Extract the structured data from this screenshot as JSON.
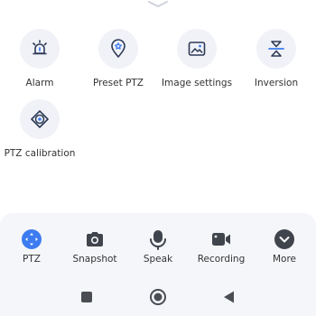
{
  "features": [
    {
      "label": "Alarm",
      "icon": "alarm-bell-icon"
    },
    {
      "label": "Preset PTZ",
      "icon": "preset-location-icon"
    },
    {
      "label": "Image settings",
      "icon": "image-icon"
    },
    {
      "label": "Inversion",
      "icon": "inversion-icon"
    },
    {
      "label": "PTZ calibration",
      "icon": "calibration-target-icon"
    }
  ],
  "toolbar": [
    {
      "label": "PTZ",
      "icon": "ptz-joystick-icon"
    },
    {
      "label": "Snapshot",
      "icon": "camera-icon"
    },
    {
      "label": "Speak",
      "icon": "microphone-icon"
    },
    {
      "label": "Recording",
      "icon": "video-camera-icon"
    },
    {
      "label": "More",
      "icon": "chevron-down-icon"
    }
  ],
  "colors": {
    "accent": "#3d7bf0",
    "icon_dark": "#2e3a55",
    "icon_bg": "#f0f2f8",
    "panel_bg": "#f5f6fa"
  }
}
